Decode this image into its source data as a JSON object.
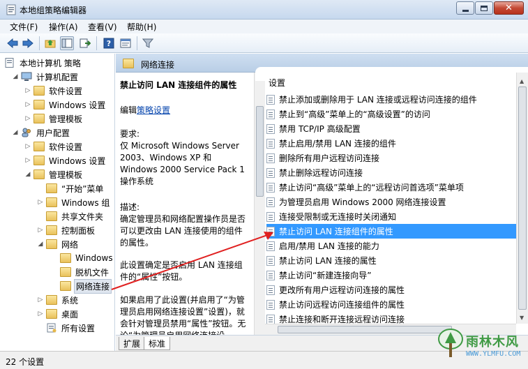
{
  "window": {
    "title": "本地组策略编辑器"
  },
  "menu": [
    "文件(F)",
    "操作(A)",
    "查看(V)",
    "帮助(H)"
  ],
  "toolbar": {
    "icons": [
      "back-icon",
      "forward-icon",
      "up-folder-icon",
      "show-hide-tree-icon",
      "export-list-icon",
      "help-icon",
      "properties-icon",
      "filter-icon"
    ]
  },
  "tree": {
    "items": [
      {
        "label": "本地计算机 策略"
      },
      {
        "label": "计算机配置"
      },
      {
        "label": "软件设置"
      },
      {
        "label": "Windows 设置"
      },
      {
        "label": "管理模板"
      },
      {
        "label": "用户配置"
      },
      {
        "label": "软件设置"
      },
      {
        "label": "Windows 设置"
      },
      {
        "label": "管理模板"
      },
      {
        "label": "“开始”菜单"
      },
      {
        "label": "Windows 组"
      },
      {
        "label": "共享文件夹"
      },
      {
        "label": "控制面板"
      },
      {
        "label": "网络"
      },
      {
        "label": "Windows"
      },
      {
        "label": "脱机文件"
      },
      {
        "label": "网络连接"
      },
      {
        "label": "系统"
      },
      {
        "label": "桌面"
      },
      {
        "label": "所有设置"
      }
    ]
  },
  "pane": {
    "header": "网络连接"
  },
  "description": {
    "title": "禁止访问 LAN 连接组件的属性",
    "edit_prefix": "编辑",
    "edit_link": "策略设置",
    "requirement_label": "要求:",
    "requirement_text": "仅 Microsoft Windows Server 2003、Windows XP 和 Windows 2000 Service Pack 1 操作系统",
    "desc_label": "描述:",
    "desc_text": "确定管理员和网络配置操作员是否可以更改由 LAN 连接使用的组件的属性。",
    "para2": "此设置确定是否启用 LAN 连接组件的“属性”按钮。",
    "para3": "如果启用了此设置(并启用了“为管理员启用网络连接设置”设置)，就会针对管理员禁用“属性”按钮。无论“为管理员启用网络连接设"
  },
  "list": {
    "header": "设置",
    "rows": [
      "禁止添加或删除用于 LAN 连接或远程访问连接的组件",
      "禁止到“高级”菜单上的“高级设置”的访问",
      "禁用 TCP/IP 高级配置",
      "禁止启用/禁用 LAN 连接的组件",
      "删除所有用户远程访问连接",
      "禁止删除远程访问连接",
      "禁止访问“高级”菜单上的“远程访问首选项”菜单项",
      "为管理员启用 Windows 2000 网络连接设置",
      "连接受限制或无连接时关闭通知",
      "禁止访问 LAN 连接组件的属性",
      "启用/禁用 LAN 连接的能力",
      "禁止访问 LAN 连接的属性",
      "禁止访问“新建连接向导”",
      "更改所有用户远程访问连接的属性",
      "禁止访问远程访问连接组件的属性",
      "禁止连接和断开连接远程访问连接"
    ],
    "selected_index": 9
  },
  "tabs": [
    "扩展",
    "标准"
  ],
  "status": {
    "text": "22 个设置"
  },
  "watermark": {
    "text": "雨林木风",
    "url": "WWW.YLMFU.COM"
  },
  "colors": {
    "selection": "#3399ff",
    "arrow": "#e02020"
  }
}
